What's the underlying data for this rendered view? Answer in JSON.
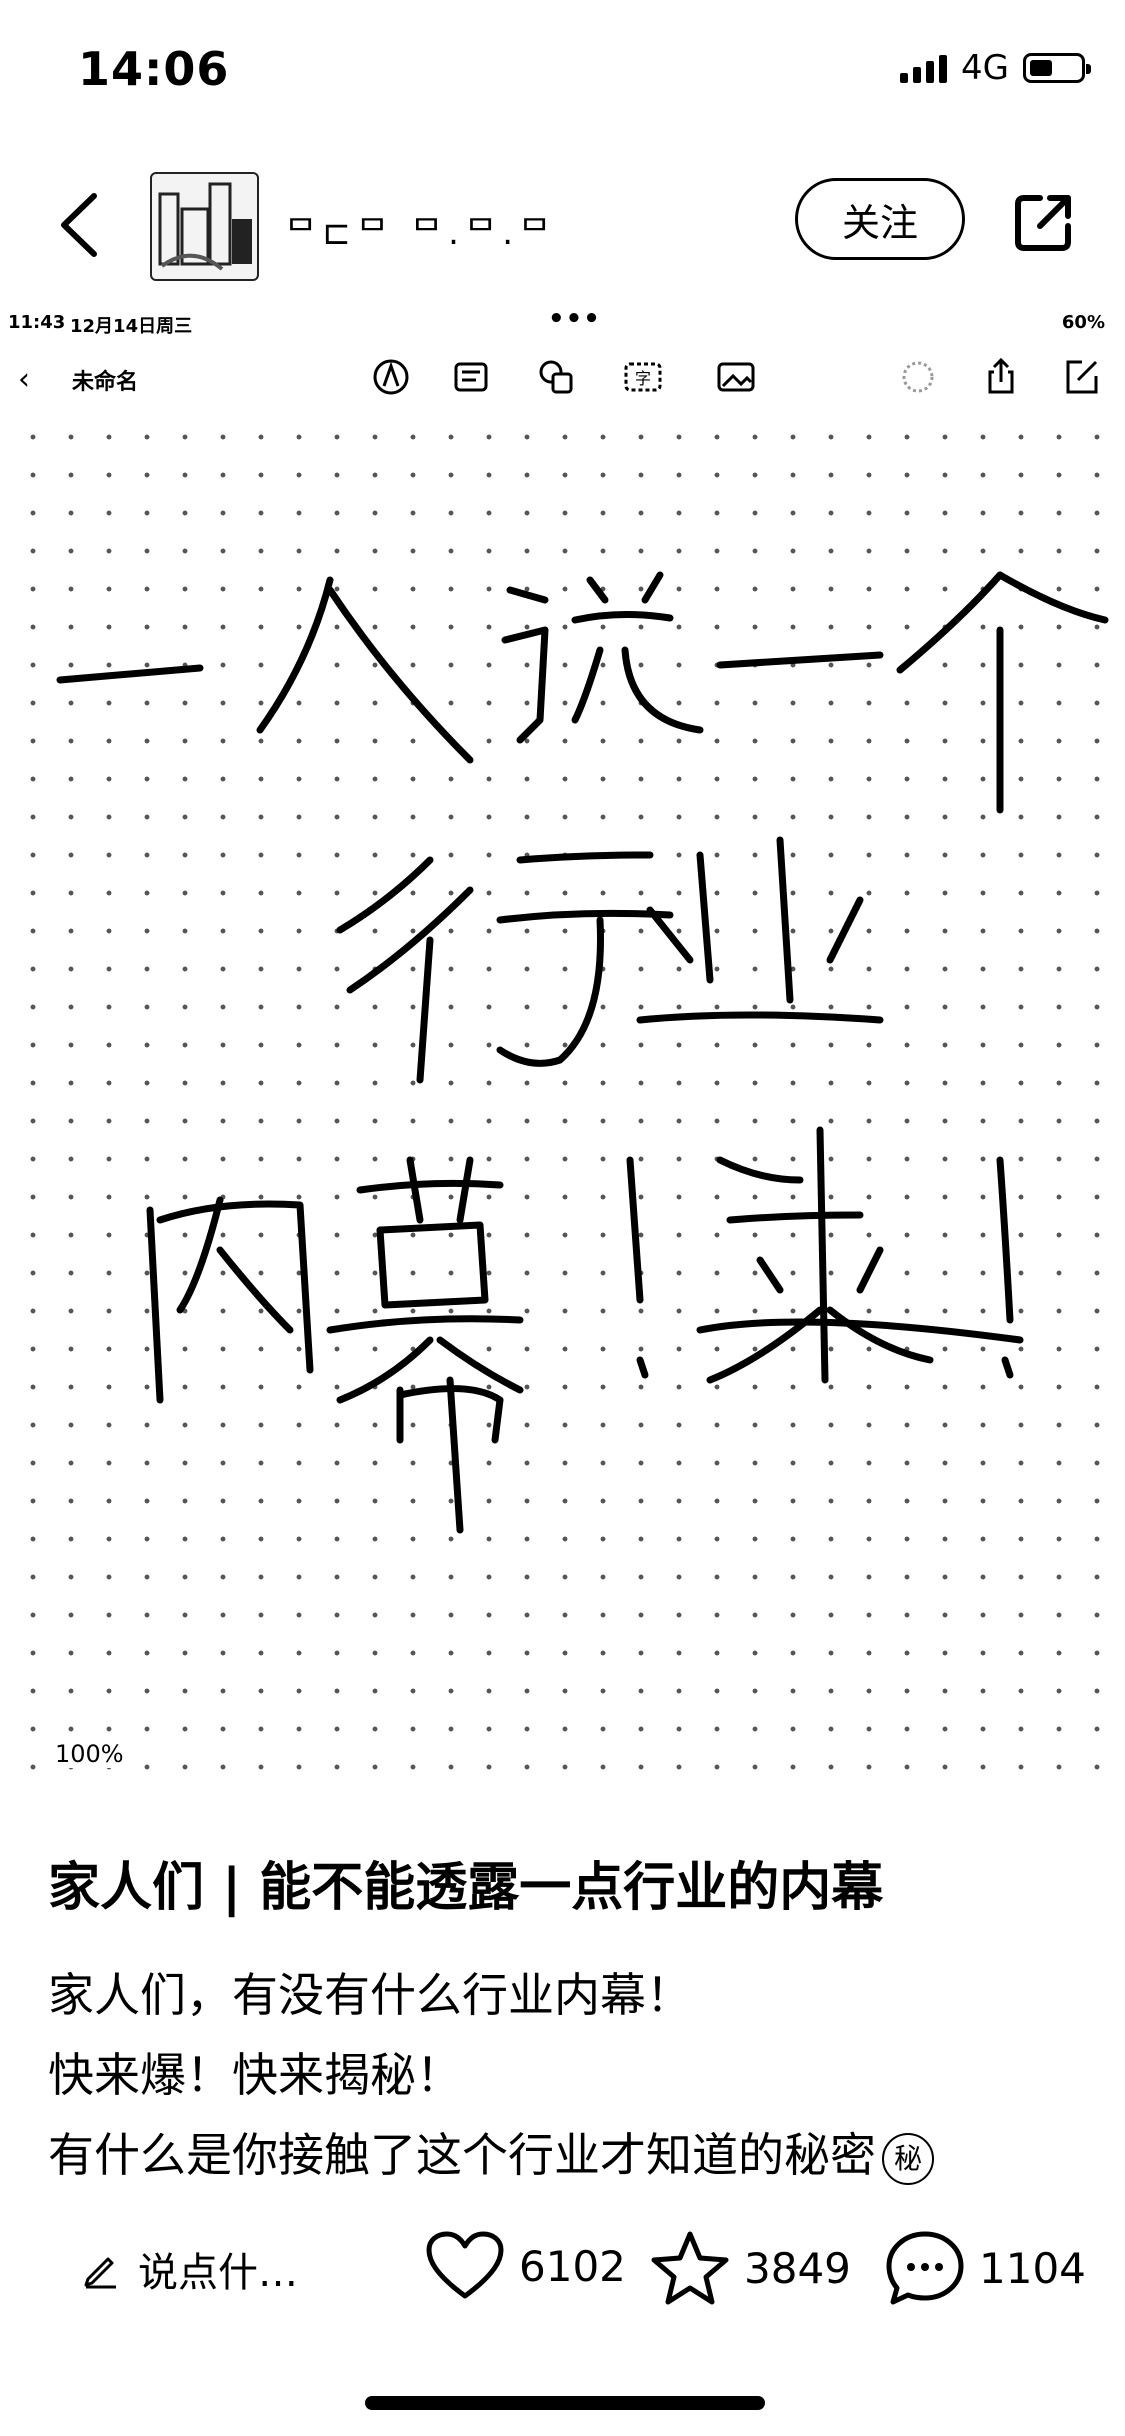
{
  "status_bar": {
    "time": "14:06",
    "network": "4G"
  },
  "nav": {
    "author_name": "ᄆ⊏ᄆ ᄆ.ᄆ.ᄆ",
    "follow_label": "关注"
  },
  "inner_screenshot": {
    "status_time": "11:43",
    "status_date": "12月14日周三",
    "status_dots": "•••",
    "status_battery": "60%",
    "doc_name": "未命名",
    "zoom": "100%",
    "handwritten_text": "一人说一个行业内幕！来！"
  },
  "post": {
    "title": "家人们 | 能不能透露一点行业的内幕",
    "lines": [
      "家人们，有没有什么行业内幕！",
      "快来爆！快来揭秘！",
      "有什么是你接触了这个行业才知道的秘密"
    ],
    "secret_emoji": "秘"
  },
  "bottom_bar": {
    "comment_placeholder": "说点什…",
    "likes": "6102",
    "favorites": "3849",
    "comments": "1104"
  },
  "icons": [
    "back-icon",
    "share-icon",
    "pencil-icon",
    "heart-icon",
    "star-icon",
    "comment-icon"
  ]
}
